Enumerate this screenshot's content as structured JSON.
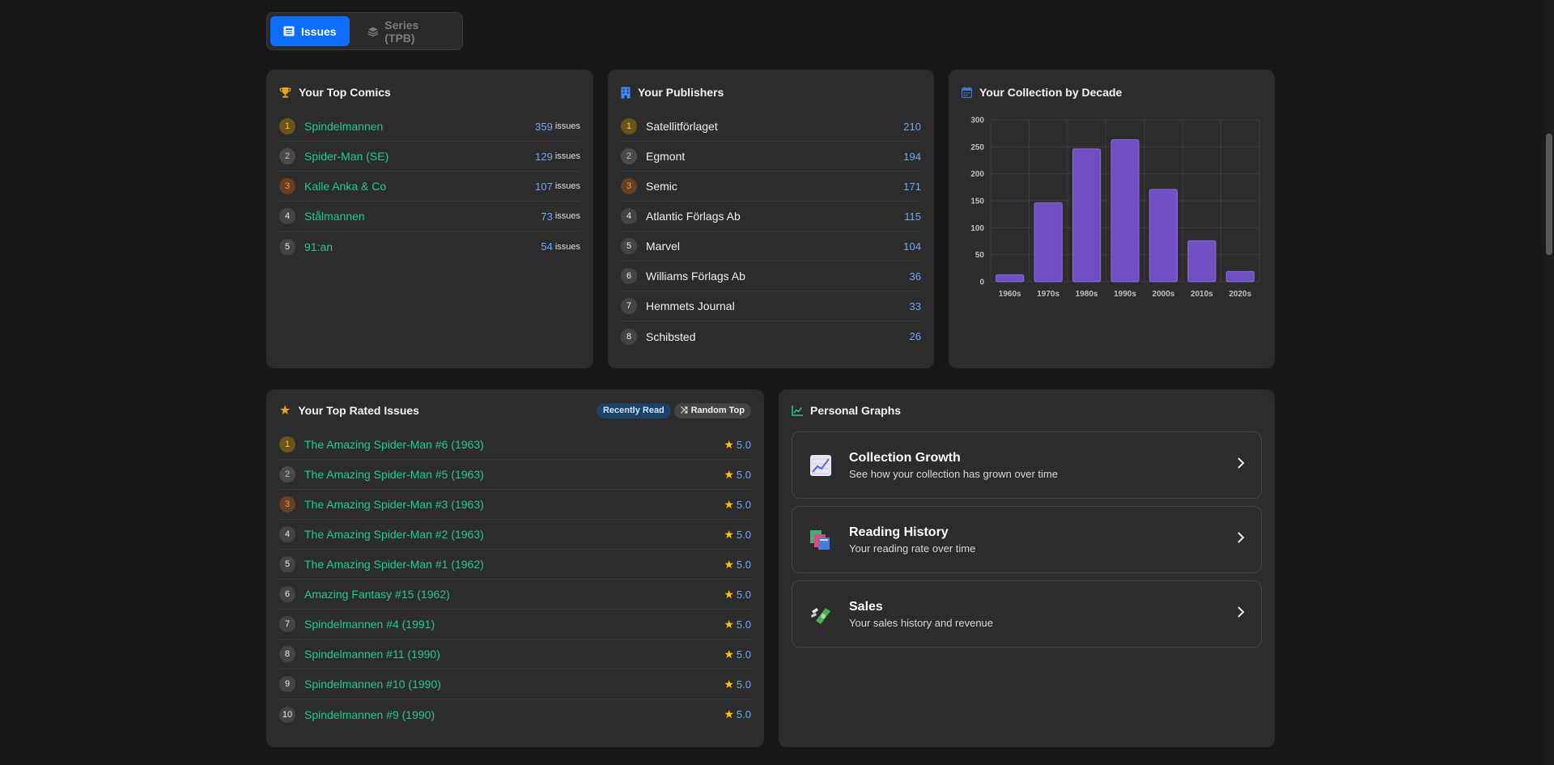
{
  "toggle": {
    "issues_label": "Issues",
    "series_label": "Series (TPB)"
  },
  "top_comics": {
    "title": "Your Top Comics",
    "suffix": "issues",
    "items": [
      {
        "rank": "1",
        "name": "Spindelmannen",
        "count": "359"
      },
      {
        "rank": "2",
        "name": "Spider-Man (SE)",
        "count": "129"
      },
      {
        "rank": "3",
        "name": "Kalle Anka & Co",
        "count": "107"
      },
      {
        "rank": "4",
        "name": "Stålmannen",
        "count": "73"
      },
      {
        "rank": "5",
        "name": "91:an",
        "count": "54"
      }
    ]
  },
  "publishers": {
    "title": "Your Publishers",
    "items": [
      {
        "rank": "1",
        "name": "Satellitförlaget",
        "count": "210"
      },
      {
        "rank": "2",
        "name": "Egmont",
        "count": "194"
      },
      {
        "rank": "3",
        "name": "Semic",
        "count": "171"
      },
      {
        "rank": "4",
        "name": "Atlantic Förlags Ab",
        "count": "115"
      },
      {
        "rank": "5",
        "name": "Marvel",
        "count": "104"
      },
      {
        "rank": "6",
        "name": "Williams Förlags Ab",
        "count": "36"
      },
      {
        "rank": "7",
        "name": "Hemmets Journal",
        "count": "33"
      },
      {
        "rank": "8",
        "name": "Schibsted",
        "count": "26"
      }
    ]
  },
  "decade": {
    "title": "Your Collection by Decade"
  },
  "chart_data": {
    "type": "bar",
    "categories": [
      "1960s",
      "1970s",
      "1980s",
      "1990s",
      "2000s",
      "2010s",
      "2020s"
    ],
    "values": [
      13,
      146,
      246,
      263,
      171,
      76,
      19
    ],
    "ylim": [
      0,
      300
    ],
    "yticks": [
      "0",
      "50",
      "100",
      "150",
      "200",
      "250",
      "300"
    ],
    "grid": true,
    "color": "#6f4fc1"
  },
  "top_rated": {
    "title": "Your Top Rated Issues",
    "recently_read": "Recently Read",
    "random_top": "Random Top",
    "items": [
      {
        "rank": "1",
        "name": "The Amazing Spider-Man #6 (1963)",
        "rating": "5.0"
      },
      {
        "rank": "2",
        "name": "The Amazing Spider-Man #5 (1963)",
        "rating": "5.0"
      },
      {
        "rank": "3",
        "name": "The Amazing Spider-Man #3 (1963)",
        "rating": "5.0"
      },
      {
        "rank": "4",
        "name": "The Amazing Spider-Man #2 (1963)",
        "rating": "5.0"
      },
      {
        "rank": "5",
        "name": "The Amazing Spider-Man #1 (1962)",
        "rating": "5.0"
      },
      {
        "rank": "6",
        "name": "Amazing Fantasy #15 (1962)",
        "rating": "5.0"
      },
      {
        "rank": "7",
        "name": "Spindelmannen #4 (1991)",
        "rating": "5.0"
      },
      {
        "rank": "8",
        "name": "Spindelmannen #11 (1990)",
        "rating": "5.0"
      },
      {
        "rank": "9",
        "name": "Spindelmannen #10 (1990)",
        "rating": "5.0"
      },
      {
        "rank": "10",
        "name": "Spindelmannen #9 (1990)",
        "rating": "5.0"
      }
    ]
  },
  "graphs": {
    "title": "Personal Graphs",
    "items": [
      {
        "title": "Collection Growth",
        "desc": "See how your collection has grown over time"
      },
      {
        "title": "Reading History",
        "desc": "Your reading rate over time"
      },
      {
        "title": "Sales",
        "desc": "Your sales history and revenue"
      }
    ]
  },
  "colors": {
    "accent": "#0d6efd",
    "link": "#20c997",
    "count": "#6ea8fe",
    "star": "#ffc107",
    "bar": "#6f4fc1"
  }
}
